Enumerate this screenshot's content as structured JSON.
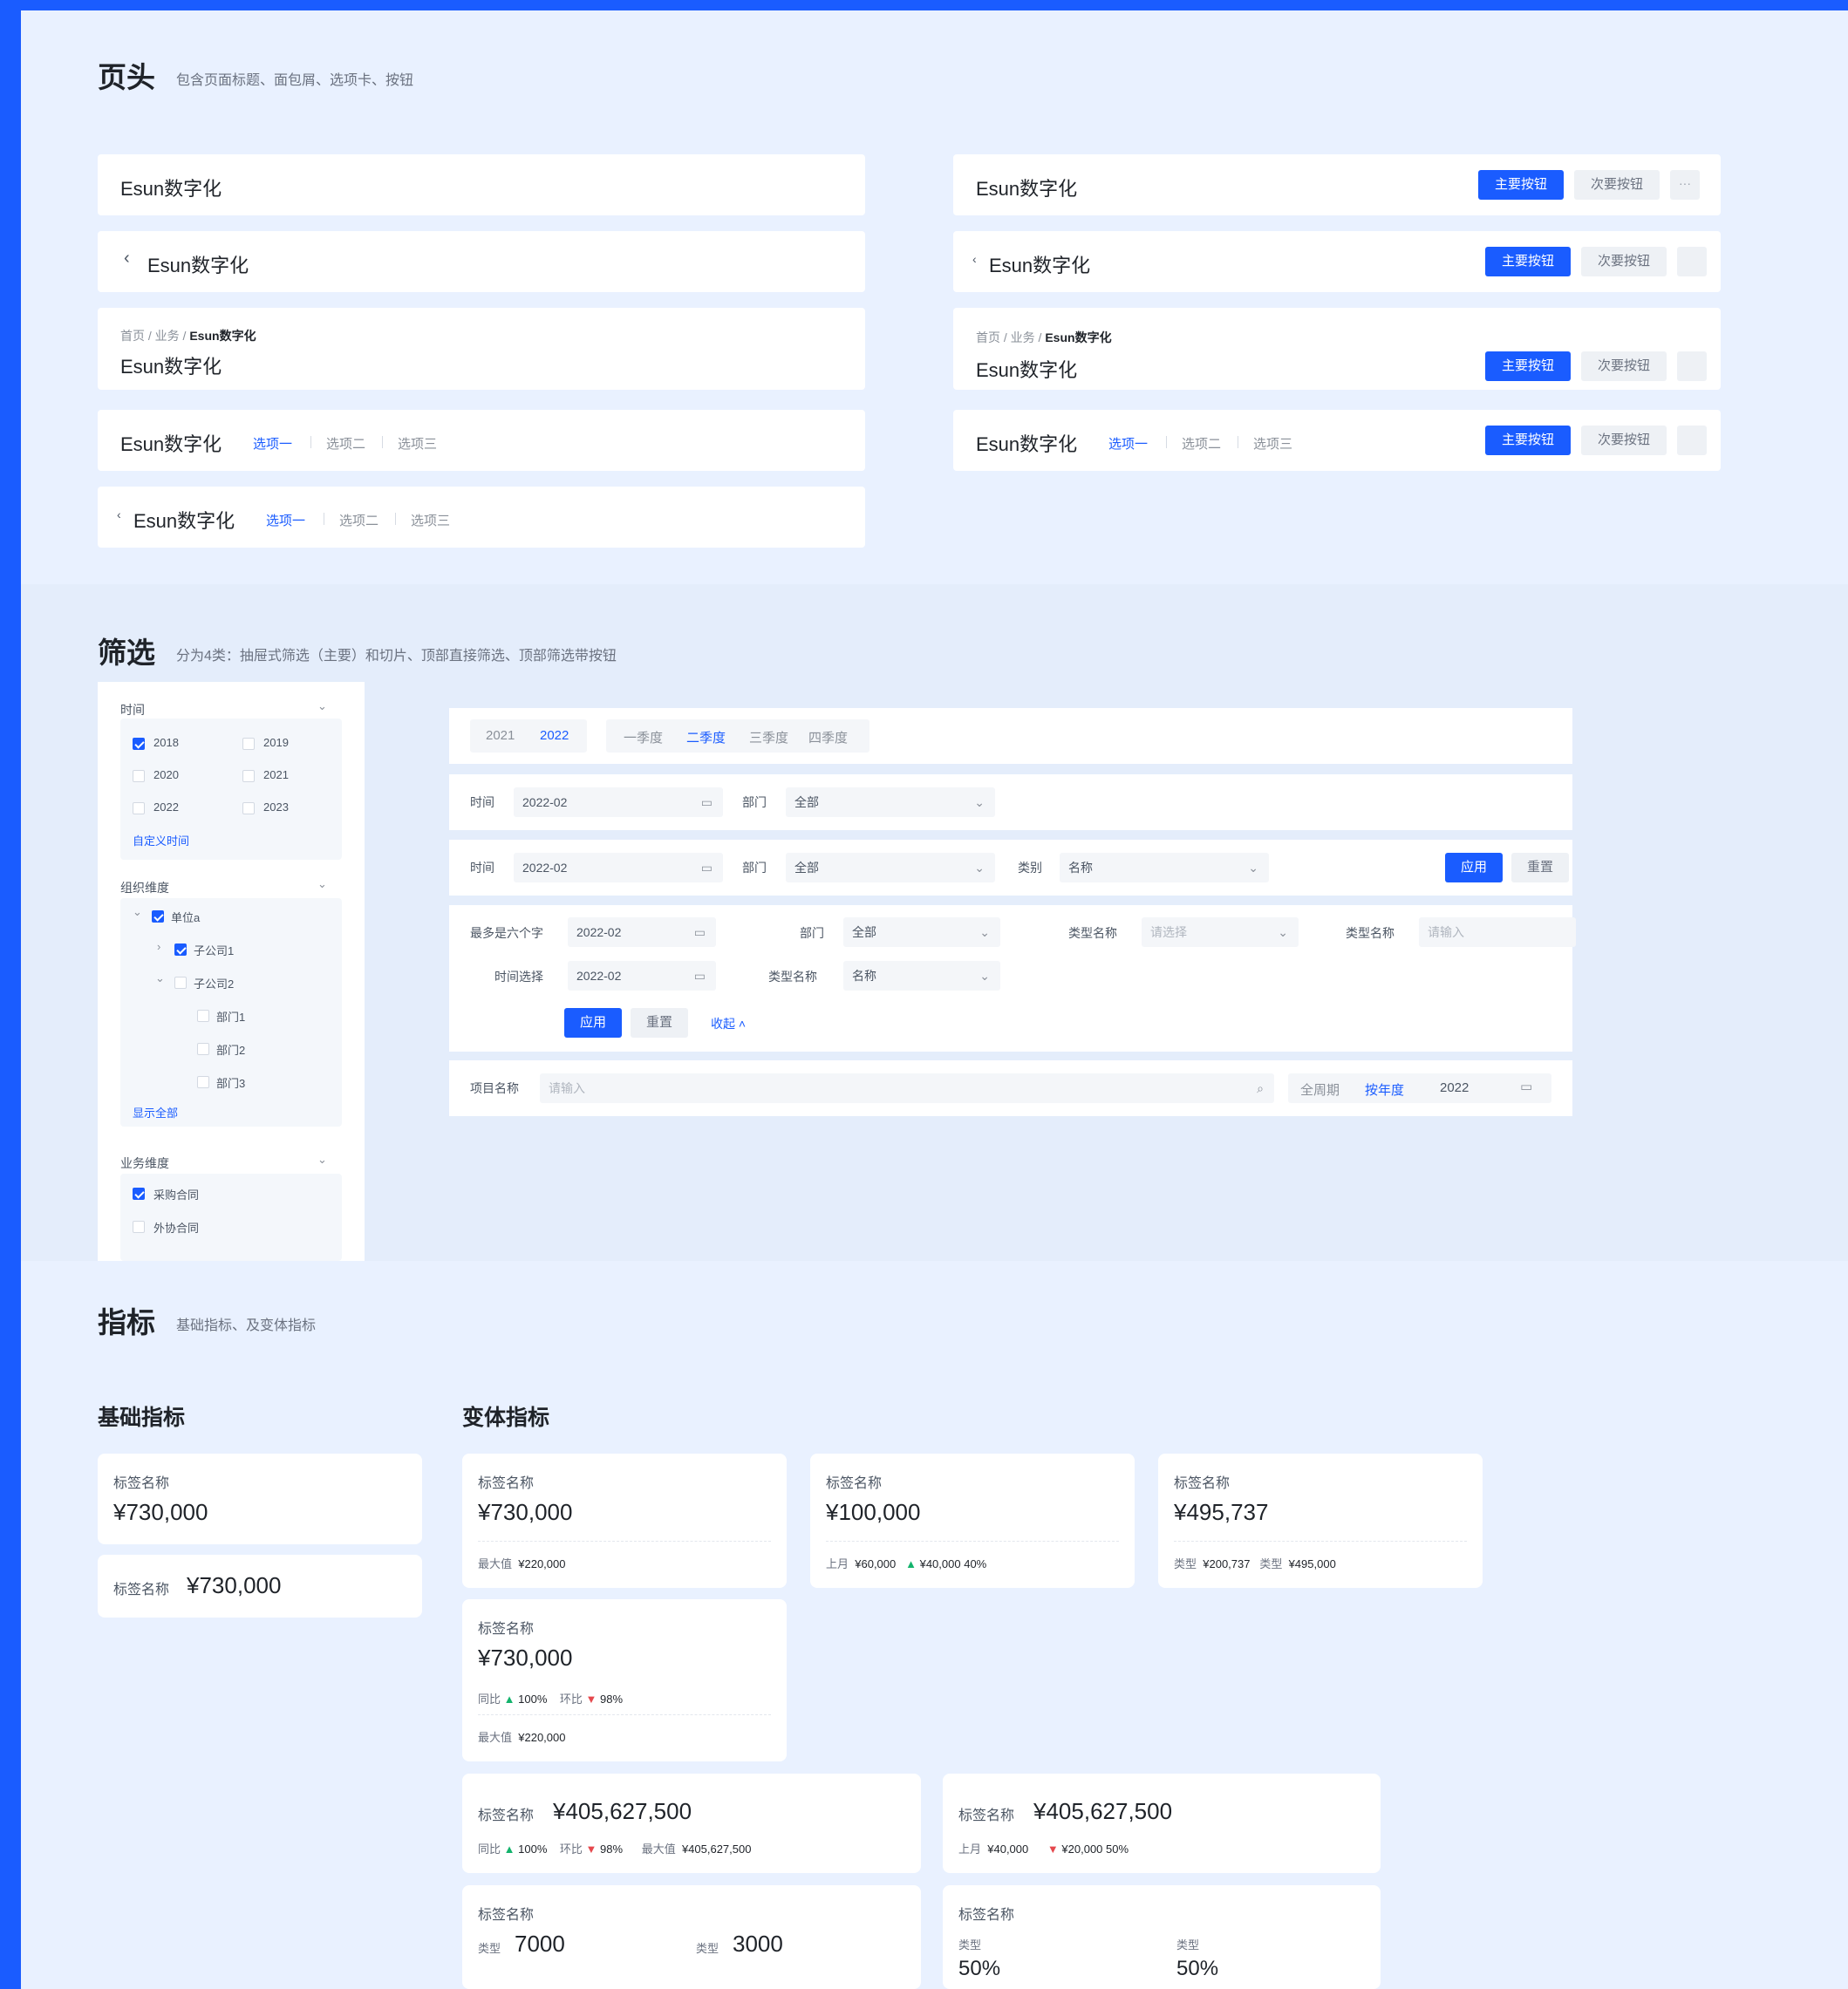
{
  "header_section": {
    "title": "页头",
    "desc": "包含页面标题、面包屑、选项卡、按钮",
    "app_title": "Esun数字化",
    "crumbs": [
      "首页",
      "业务",
      "Esun数字化"
    ],
    "tabs": [
      "选项一",
      "选项二",
      "选项三"
    ],
    "primary_btn": "主要按钮",
    "secondary_btn": "次要按钮",
    "more_btn": "···"
  },
  "filter_section": {
    "title": "筛选",
    "desc": "分为4类：抽屉式筛选（主要）和切片、顶部直接筛选、顶部筛选带按钮",
    "drawer": {
      "time_label": "时间",
      "years": [
        "2018",
        "2019",
        "2020",
        "2021",
        "2022",
        "2023"
      ],
      "custom_time": "自定义时间",
      "org_label": "组织维度",
      "org_root": "单位a",
      "org_child1": "子公司1",
      "org_child2": "子公司2",
      "depts": [
        "部门1",
        "部门2",
        "部门3"
      ],
      "show_all": "显示全部",
      "biz_label": "业务维度",
      "biz_items": [
        "采购合同",
        "外协合同"
      ]
    },
    "slicer": {
      "years": [
        "2021",
        "2022"
      ],
      "quarters": [
        "一季度",
        "二季度",
        "三季度",
        "四季度"
      ]
    },
    "time_label": "时间",
    "time_value": "2022-02",
    "dept_label": "部门",
    "dept_value": "全部",
    "type_label": "类别",
    "type_value": "名称",
    "apply_btn": "应用",
    "reset_btn": "重置",
    "row4": {
      "max_label": "最多是六个字",
      "date_value": "2022-02",
      "dept_label": "部门",
      "dept_value": "全部",
      "typename_label": "类型名称",
      "select_ph": "请选择",
      "input_label": "类型名称",
      "input_ph": "请输入",
      "timesel_label": "时间选择",
      "typename2_label": "类型名称",
      "typename2_value": "名称",
      "collapse": "收起"
    },
    "row5": {
      "project_label": "项目名称",
      "project_ph": "请输入",
      "period_all": "全周期",
      "period_year": "按年度",
      "year_value": "2022"
    }
  },
  "metric_section": {
    "title": "指标",
    "desc": "基础指标、及变体指标",
    "basic_title": "基础指标",
    "variant_title": "变体指标",
    "label": "标签名称",
    "v730": "¥730,000",
    "v100": "¥100,000",
    "v495": "¥495,737",
    "v405": "¥405,627,500",
    "max_label": "最大值",
    "max_val": "¥220,000",
    "max_val2": "¥405,627,500",
    "last_month": "上月",
    "lm_val": "¥60,000",
    "lm_val2": "¥40,000",
    "delta_up": "¥40,000",
    "delta_down": "¥20,000",
    "pct40": "40%",
    "pct50": "50%",
    "type_label": "类型",
    "t_val1": "¥200,737",
    "t_val2": "¥495,000",
    "yoy": "同比",
    "yoy_val": "100%",
    "mom": "环比",
    "mom_val": "98%",
    "n7000": "7000",
    "n3000": "3000",
    "p50": "50%"
  }
}
